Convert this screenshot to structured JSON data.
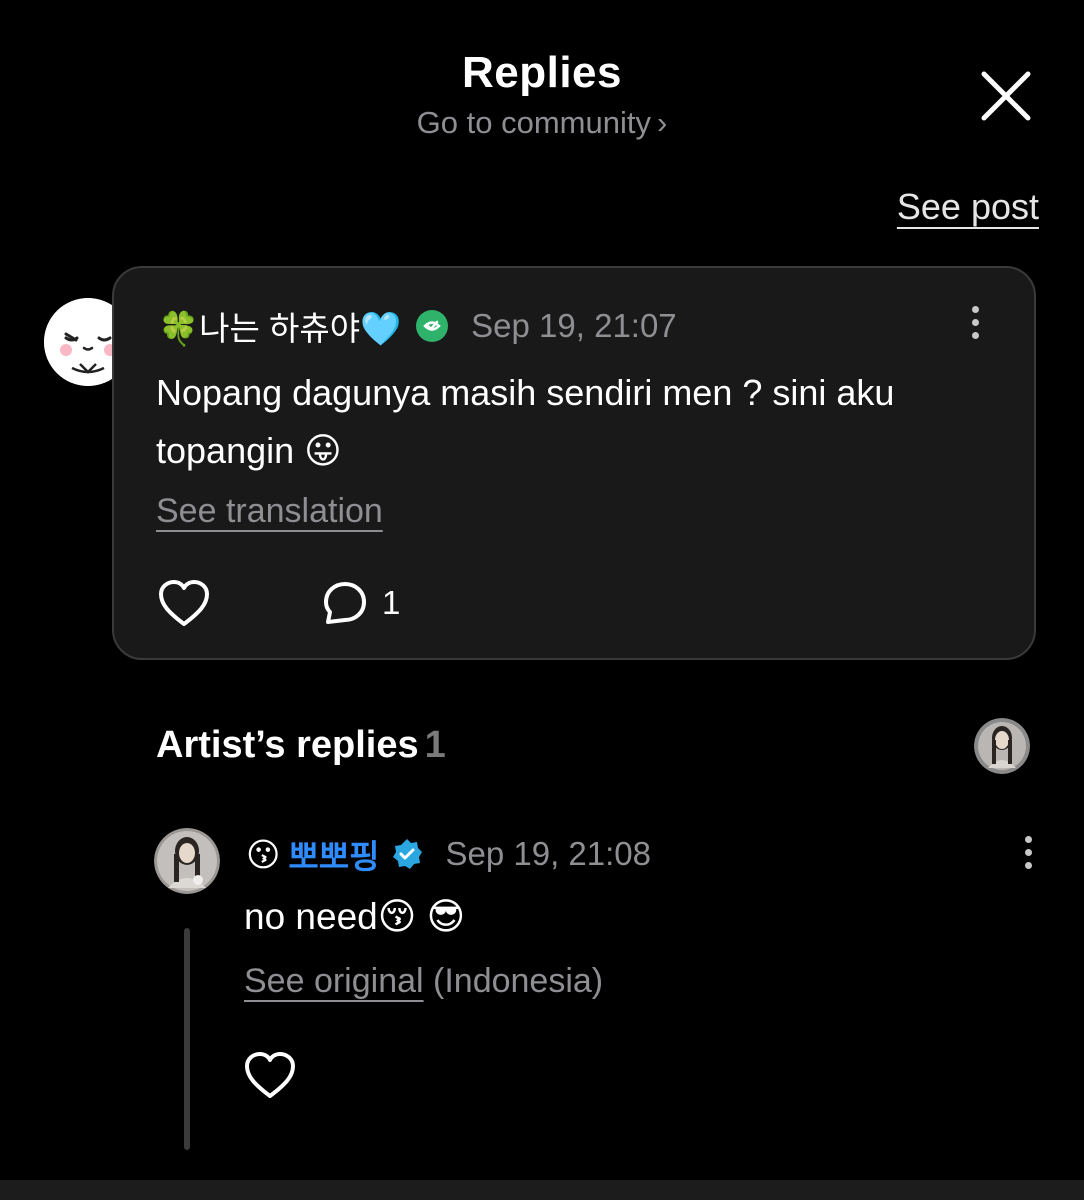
{
  "header": {
    "title": "Replies",
    "subtitle": "Go to community",
    "subtitle_chevron": "›",
    "close_icon": "close-icon"
  },
  "see_post": "See post",
  "comment": {
    "author_name": "🍀나는 하츄야🩵",
    "verified_badge": "fan-badge-icon",
    "timestamp": "Sep 19, 21:07",
    "body": "Nopang dagunya masih sendiri men ? sini aku topangin 😛",
    "see_translation": "See translation",
    "like_icon": "heart-icon",
    "reply_icon": "comment-icon",
    "reply_count": "1"
  },
  "artist_section": {
    "title": "Artist’s replies",
    "count": "1"
  },
  "reply": {
    "author_prefix": "😗",
    "author_name": "뽀뽀핑",
    "verified_badge": "artist-verified-icon",
    "timestamp": "Sep 19, 21:08",
    "body": "no need😚 😎",
    "see_original": "See original",
    "original_language": "(Indonesia)",
    "like_icon": "heart-icon"
  },
  "colors": {
    "background": "#000000",
    "card": "#191919",
    "muted": "#8e8e93",
    "artist_name": "#2f8cff",
    "fan_badge": "#2fb36b",
    "artist_badge": "#2aa6e0"
  }
}
